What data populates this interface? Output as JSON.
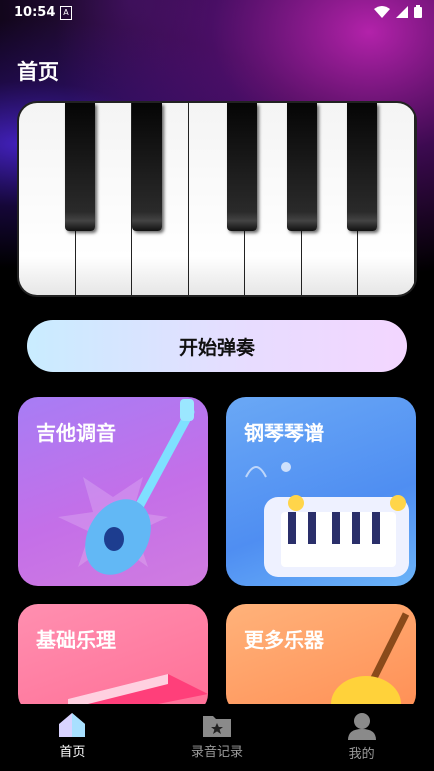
{
  "status": {
    "time": "10:54",
    "a_icon": "A"
  },
  "header": {
    "title": "首页"
  },
  "actions": {
    "start_label": "开始弹奏"
  },
  "cards": [
    {
      "title": "吉他调音",
      "icon": "guitar"
    },
    {
      "title": "钢琴琴谱",
      "icon": "keyboard"
    },
    {
      "title": "基础乐理",
      "icon": "book"
    },
    {
      "title": "更多乐器",
      "icon": "violin"
    }
  ],
  "tabs": [
    {
      "label": "首页",
      "icon": "home-icon",
      "active": true
    },
    {
      "label": "录音记录",
      "icon": "folder-star-icon",
      "active": false
    },
    {
      "label": "我的",
      "icon": "user-icon",
      "active": false
    }
  ]
}
